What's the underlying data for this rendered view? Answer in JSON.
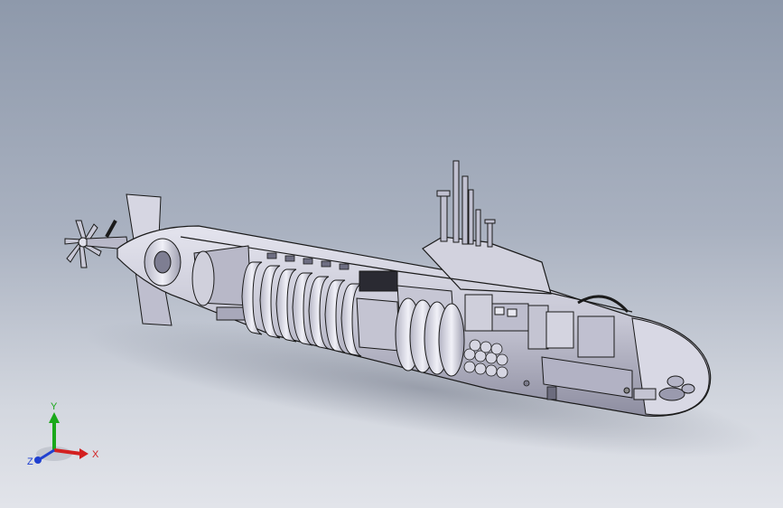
{
  "viewport": {
    "background_top": "#8e99ab",
    "background_bottom": "#e2e4ea"
  },
  "model": {
    "body_color": "#c8c8d6",
    "shade_color": "#8c8c9e",
    "edge_color": "#1a1a1a"
  },
  "triad": {
    "x_label": "X",
    "y_label": "Y",
    "z_label": "Z",
    "x_color": "#d32020",
    "y_color": "#1aa81a",
    "z_color": "#2040d0"
  }
}
